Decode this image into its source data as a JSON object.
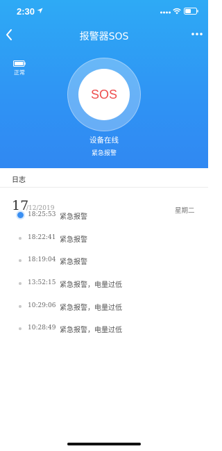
{
  "status_bar": {
    "time": "2:30",
    "icons": [
      "location-arrow-icon",
      "signal-icon",
      "wifi-icon",
      "battery-icon"
    ]
  },
  "nav": {
    "title": "报警器SOS",
    "back_icon": "chevron-left-icon",
    "more_icon": "more-dots-icon"
  },
  "device": {
    "battery_status": "正常",
    "sos_label": "SOS",
    "status_text": "设备在线",
    "alarm_text": "紧急报警"
  },
  "log": {
    "title": "日志",
    "day": "17",
    "month_year": "/12/2019",
    "weekday": "星期二",
    "entries": [
      {
        "time": "18:25:53",
        "text": "紧急报警"
      },
      {
        "time": "18:22:41",
        "text": "紧急报警"
      },
      {
        "time": "18:19:04",
        "text": "紧急报警"
      },
      {
        "time": "13:52:15",
        "text": "紧急报警，电量过低"
      },
      {
        "time": "10:29:06",
        "text": "紧急报警，电量过低"
      },
      {
        "time": "10:28:49",
        "text": "紧急报警，电量过低"
      }
    ]
  },
  "colors": {
    "header_blue": "#2f93f4",
    "sos_red": "#ee4f4f",
    "active_dot": "#3a8ff2"
  }
}
